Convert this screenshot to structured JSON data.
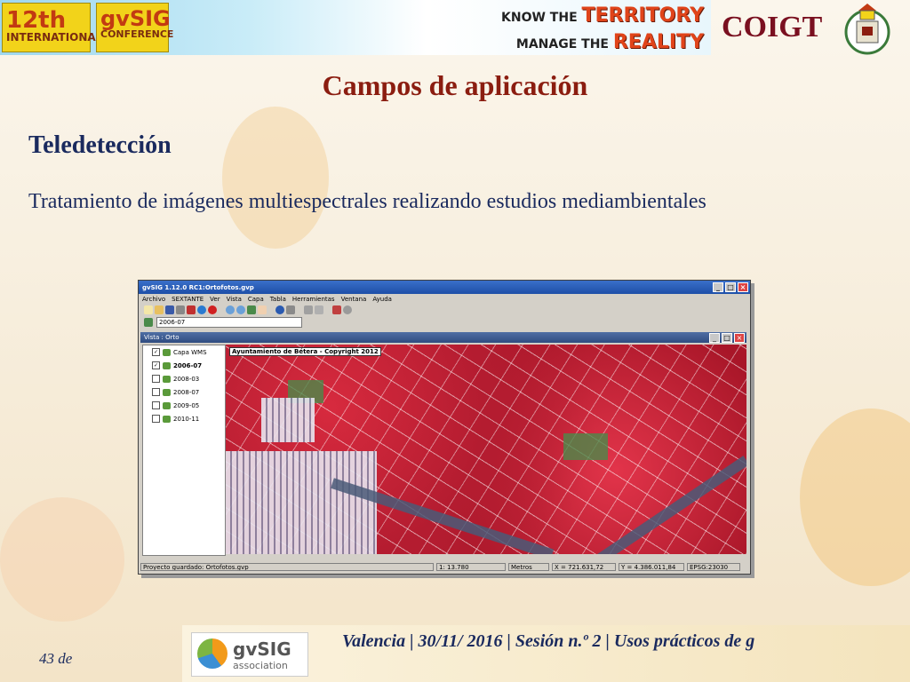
{
  "header": {
    "badge_12_line1": "12th",
    "badge_12_line2": "INTERNATIONAL",
    "badge_gvsig_line1": "gvSIG",
    "badge_gvsig_line2": "CONFERENCE",
    "know_prefix": "KNOW THE",
    "know_highlight": "TERRITORY",
    "manage_prefix": "MANAGE THE",
    "manage_highlight": "REALITY",
    "org": "COIGT"
  },
  "slide": {
    "title": "Campos de aplicación",
    "subtitle": "Teledetección",
    "body": "Tratamiento de imágenes multiespectrales realizando estudios mediambientales"
  },
  "app": {
    "window_title": "gvSIG 1.12.0 RC1:Ortofotos.gvp",
    "menu": [
      "Archivo",
      "SEXTANTE",
      "Ver",
      "Vista",
      "Capa",
      "Tabla",
      "Herramientas",
      "Ventana",
      "Ayuda"
    ],
    "combo_value": "2006-07",
    "view_title": "Vista : Orto",
    "layers": [
      {
        "name": "Capa WMS",
        "checked": true
      },
      {
        "name": "2006-07",
        "checked": true
      },
      {
        "name": "2008-03",
        "checked": false
      },
      {
        "name": "2008-07",
        "checked": false
      },
      {
        "name": "2009-05",
        "checked": false
      },
      {
        "name": "2010-11",
        "checked": false
      }
    ],
    "map_label": "Ayuntamiento de Bétera - Copyright 2012",
    "status": {
      "message": "Proyecto guardado: Ortofotos.gvp",
      "scale": "1: 13.780",
      "units": "Metros",
      "x": "X = 721.631,72",
      "y": "Y = 4.386.011,84",
      "crs": "EPSG:23030"
    }
  },
  "footer": {
    "logo_name": "gvSIG",
    "logo_sub": "association",
    "text": "Valencia | 30/11/ 2016 | Sesión n.º 2 | Usos prácticos de g",
    "page": "43 de"
  },
  "colors": {
    "title": "#8b1d10",
    "text_dark_blue": "#1a2a5e",
    "org": "#7a1020"
  }
}
